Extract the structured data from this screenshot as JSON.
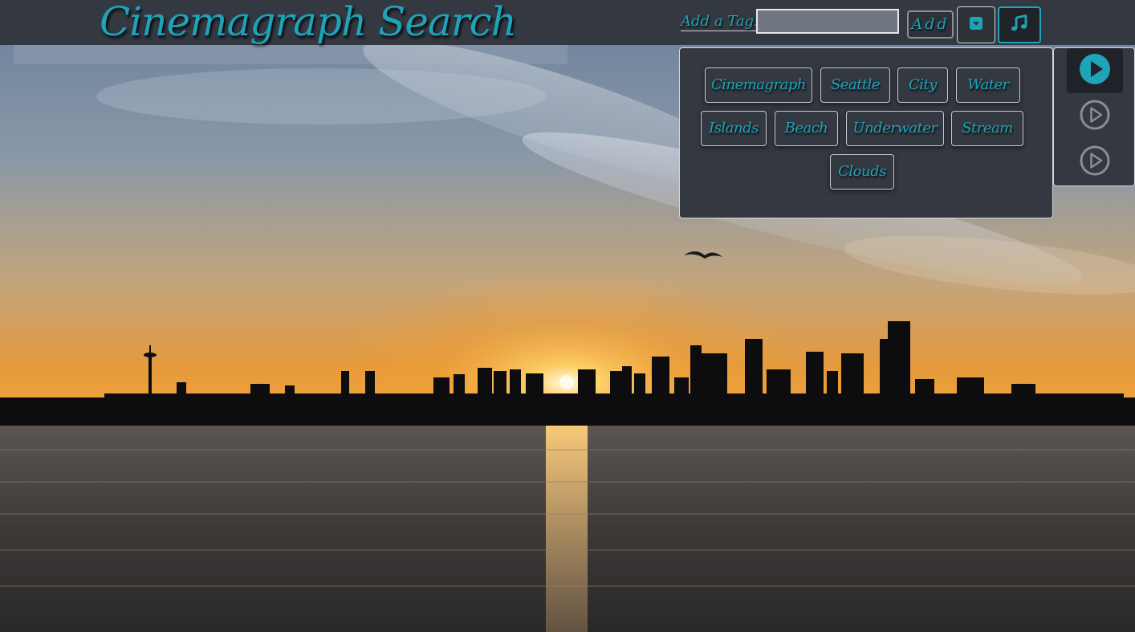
{
  "app": {
    "title": "Cinemagraph Search"
  },
  "header": {
    "add_tag_label": "Add a Tag:",
    "tag_input_value": "",
    "tag_input_placeholder": "",
    "add_button_label": "Add",
    "dropdown_icon": "caret-square-down-icon",
    "music_icon": "music-note-icon"
  },
  "tags": [
    "Cinemagraph",
    "Seattle",
    "City",
    "Water",
    "Islands",
    "Beach",
    "Underwater",
    "Stream",
    "Clouds"
  ],
  "music": {
    "tracks": [
      {
        "icon": "play-circle-icon",
        "active": true
      },
      {
        "icon": "play-circle-icon",
        "active": false
      },
      {
        "icon": "play-circle-icon",
        "active": false
      }
    ]
  },
  "colors": {
    "accent": "#1fa3b8",
    "header_bg": "#333841",
    "panel_bg": "#333841",
    "input_bg": "#707782",
    "inactive_icon": "#8a8d92"
  },
  "background": {
    "scene": "sunset-city-skyline-over-water"
  }
}
